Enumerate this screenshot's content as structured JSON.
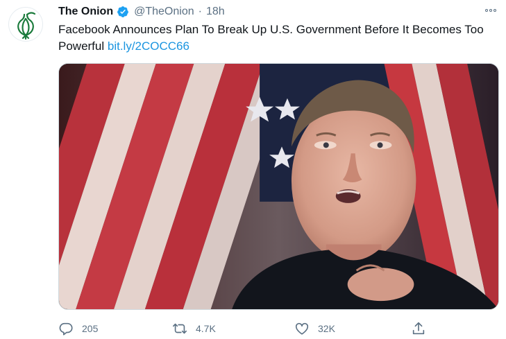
{
  "tweet": {
    "display_name": "The Onion",
    "handle": "@TheOnion",
    "separator": "·",
    "timestamp": "18h",
    "text": "Facebook Announces Plan To Break Up U.S. Government Before It Becomes Too Powerful",
    "link": "bit.ly/2COCC66",
    "verified": true,
    "avatar_icon": "onion-logo-icon",
    "media_description_icon": "photo"
  },
  "actions": {
    "reply_count": "205",
    "retweet_count": "4.7K",
    "like_count": "32K"
  },
  "colors": {
    "link": "#1b95e0",
    "verified": "#1da1f2",
    "secondary_text": "#5b7083",
    "onion_green": "#1a7a3b"
  }
}
